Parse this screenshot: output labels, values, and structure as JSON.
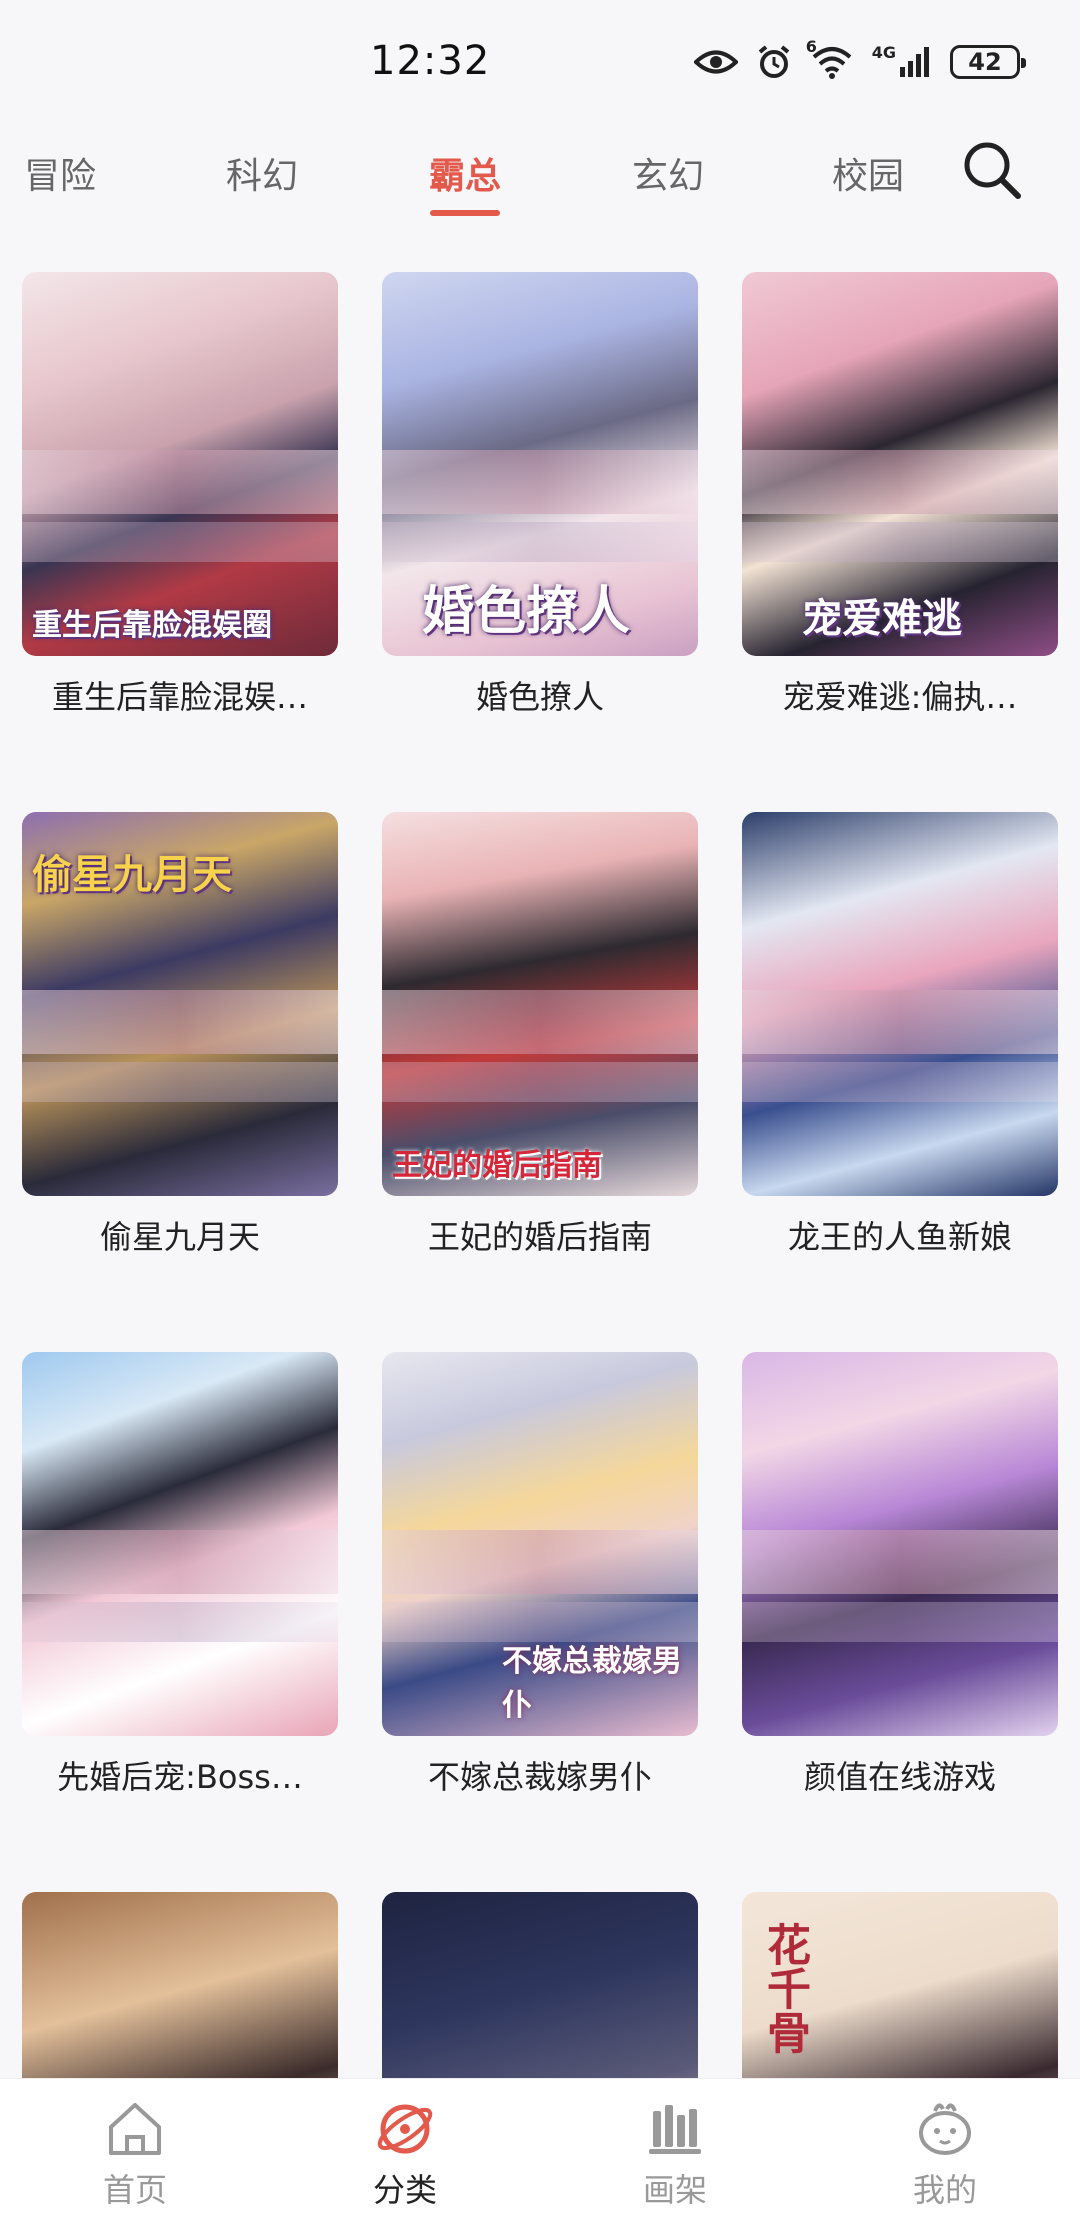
{
  "status_bar": {
    "time": "12:32",
    "network": "4G",
    "wifi_badge": "6",
    "battery": "42",
    "icons": [
      "eye-icon",
      "alarm-icon",
      "wifi-icon",
      "signal-icon",
      "battery-icon"
    ]
  },
  "tabs": [
    {
      "label": "冒险",
      "active": false
    },
    {
      "label": "科幻",
      "active": false
    },
    {
      "label": "霸总",
      "active": true
    },
    {
      "label": "玄幻",
      "active": false
    },
    {
      "label": "校园",
      "active": false
    }
  ],
  "accent_color": "#e35a4c",
  "comics": [
    {
      "title": "重生后靠脸混娱…",
      "cover_text": "重生后靠脸混娱圈"
    },
    {
      "title": "婚色撩人",
      "cover_text": "婚色撩人"
    },
    {
      "title": "宠爱难逃:偏执…",
      "cover_text": "宠爱难逃"
    },
    {
      "title": "偷星九月天",
      "cover_text": "偷星九月天"
    },
    {
      "title": "王妃的婚后指南",
      "cover_text": "王妃的婚后指南"
    },
    {
      "title": "龙王的人鱼新娘",
      "cover_text": ""
    },
    {
      "title": "先婚后宠:Boss…",
      "cover_text": ""
    },
    {
      "title": "不嫁总裁嫁男仆",
      "cover_text": "不嫁总裁嫁男仆"
    },
    {
      "title": "颜值在线游戏",
      "cover_text": ""
    },
    {
      "title": "",
      "cover_text": ""
    },
    {
      "title": "",
      "cover_text": ""
    },
    {
      "title": "",
      "cover_text": "花千骨"
    }
  ],
  "bottom_nav": [
    {
      "label": "首页",
      "icon": "home-icon",
      "active": false
    },
    {
      "label": "分类",
      "icon": "category-icon",
      "active": true
    },
    {
      "label": "画架",
      "icon": "shelf-icon",
      "active": false
    },
    {
      "label": "我的",
      "icon": "profile-icon",
      "active": false
    }
  ]
}
